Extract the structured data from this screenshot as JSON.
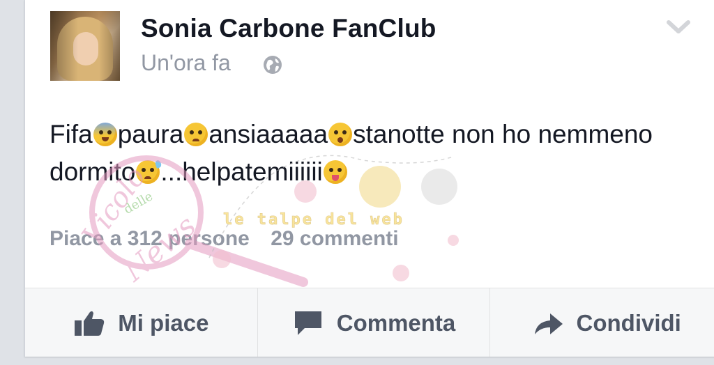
{
  "post": {
    "author": "Sonia Carbone FanClub",
    "timestamp": "Un'ora fa",
    "privacy_icon": "globe-icon",
    "menu_icon": "chevron-down-icon",
    "text_segments": [
      "Fifa",
      "paura",
      "ansiaaaaa",
      "stanotte non ho nemmeno dormito",
      "...helpatemiiiiii"
    ],
    "emojis": [
      "fearful-screaming-face",
      "disappointed-face",
      "hushed-face",
      "sweat-face",
      "tongue-winking-face"
    ]
  },
  "stats": {
    "likes": "Piace a 312 persone",
    "comments": "29 commenti"
  },
  "actions": {
    "like": "Mi piace",
    "comment": "Commenta",
    "share": "Condividi"
  },
  "watermark": {
    "logo_text_1": "Vicolo",
    "logo_text_2": "delle",
    "logo_text_3": "News",
    "banner": "le talpe del web"
  },
  "colors": {
    "text": "#141823",
    "muted": "#9197a3",
    "action_text": "#4e5665",
    "action_bg": "#f6f7f8",
    "watermark_pink": "#e49ac0"
  }
}
